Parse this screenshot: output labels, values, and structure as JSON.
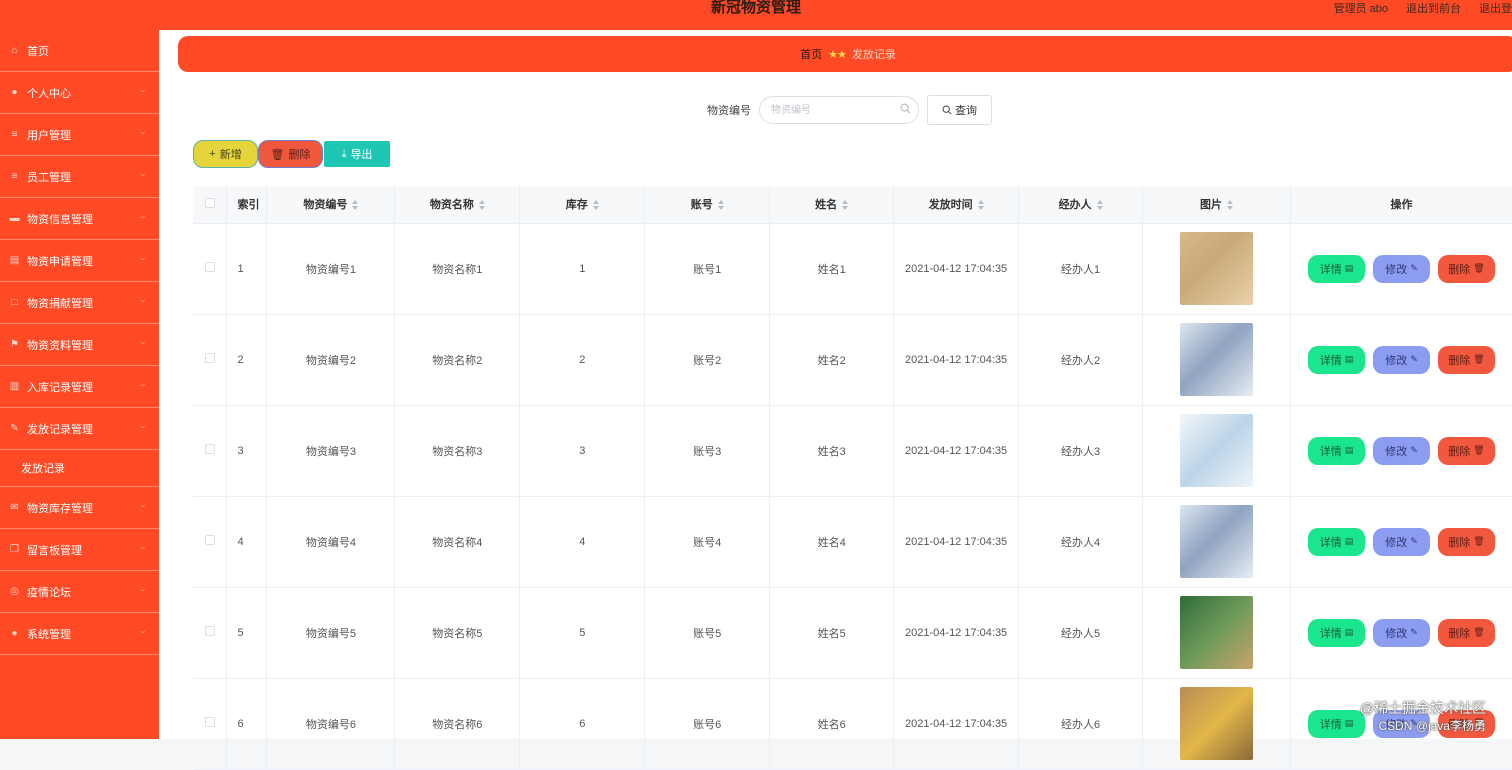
{
  "header": {
    "title": "新冠物资管理",
    "admin": "管理员 abo",
    "to_front": "退出到前台",
    "logout": "退出登"
  },
  "sidebar": {
    "items": [
      {
        "label": "首页",
        "icon": "home-icon",
        "chevron": false
      },
      {
        "label": "个人中心",
        "icon": "user-icon",
        "chevron": true
      },
      {
        "label": "用户管理",
        "icon": "list-icon",
        "chevron": true
      },
      {
        "label": "员工管理",
        "icon": "list-icon",
        "chevron": true
      },
      {
        "label": "物资信息管理",
        "icon": "chat-icon",
        "chevron": true
      },
      {
        "label": "物资申请管理",
        "icon": "doc-icon",
        "chevron": true
      },
      {
        "label": "物资捐献管理",
        "icon": "box-icon",
        "chevron": true
      },
      {
        "label": "物资资料管理",
        "icon": "flag-icon",
        "chevron": true
      },
      {
        "label": "入库记录管理",
        "icon": "chart-icon",
        "chevron": true
      },
      {
        "label": "发放记录管理",
        "icon": "edit-icon",
        "chevron": true,
        "expanded": true
      },
      {
        "label": "物资库存管理",
        "icon": "mail-icon",
        "chevron": true
      },
      {
        "label": "留言板管理",
        "icon": "copy-icon",
        "chevron": true
      },
      {
        "label": "疫情论坛",
        "icon": "compass-icon",
        "chevron": true
      },
      {
        "label": "系统管理",
        "icon": "user-icon",
        "chevron": true
      }
    ],
    "submenu_label": "发放记录"
  },
  "breadcrumb": {
    "home": "首页",
    "current": "发放记录"
  },
  "search": {
    "label": "物资编号",
    "placeholder": "物资编号",
    "button": "查询"
  },
  "actions": {
    "add": "新增",
    "delete": "删除",
    "export": "导出"
  },
  "table": {
    "columns": [
      "索引",
      "物资编号",
      "物资名称",
      "库存",
      "账号",
      "姓名",
      "发放时间",
      "经办人",
      "图片",
      "操作"
    ],
    "rows": [
      {
        "index": "1",
        "code": "物资编号1",
        "name": "物资名称1",
        "stock": "1",
        "account": "账号1",
        "person": "姓名1",
        "time": "2021-04-12 17:04:35",
        "handler": "经办人1"
      },
      {
        "index": "2",
        "code": "物资编号2",
        "name": "物资名称2",
        "stock": "2",
        "account": "账号2",
        "person": "姓名2",
        "time": "2021-04-12 17:04:35",
        "handler": "经办人2"
      },
      {
        "index": "3",
        "code": "物资编号3",
        "name": "物资名称3",
        "stock": "3",
        "account": "账号3",
        "person": "姓名3",
        "time": "2021-04-12 17:04:35",
        "handler": "经办人3"
      },
      {
        "index": "4",
        "code": "物资编号4",
        "name": "物资名称4",
        "stock": "4",
        "account": "账号4",
        "person": "姓名4",
        "time": "2021-04-12 17:04:35",
        "handler": "经办人4"
      },
      {
        "index": "5",
        "code": "物资编号5",
        "name": "物资名称5",
        "stock": "5",
        "account": "账号5",
        "person": "姓名5",
        "time": "2021-04-12 17:04:35",
        "handler": "经办人5"
      },
      {
        "index": "6",
        "code": "物资编号6",
        "name": "物资名称6",
        "stock": "6",
        "account": "账号6",
        "person": "姓名6",
        "time": "2021-04-12 17:04:35",
        "handler": "经办人6"
      }
    ],
    "op_detail": "详情",
    "op_edit": "修改",
    "op_delete": "删除"
  },
  "watermark": {
    "line1": "@稀土掘金技术社区",
    "line2": "CSDN @java李杨勇"
  },
  "colors": {
    "brand": "#ff4a25",
    "detail_btn": "#19e68d",
    "edit_btn": "#8c9cf0",
    "delete_btn": "#f2583e",
    "export_btn": "#1dc7b4",
    "add_btn": "#e5d43a"
  }
}
